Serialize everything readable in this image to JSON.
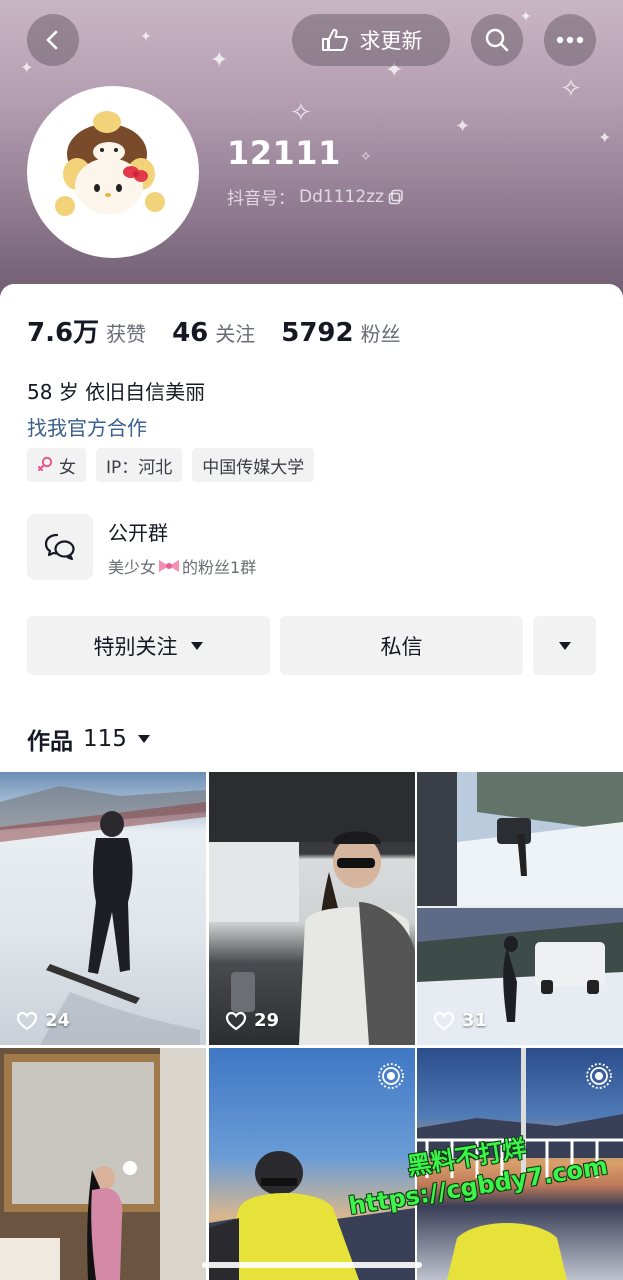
{
  "header": {
    "update_button_label": "求更新",
    "nickname": "12111",
    "douyin_id_label": "抖音号：",
    "douyin_id": "Dd1112zz"
  },
  "stats": [
    {
      "value": "7.6万",
      "label": "获赞"
    },
    {
      "value": "46",
      "label": "关注"
    },
    {
      "value": "5792",
      "label": "粉丝"
    }
  ],
  "bio": "58 岁 依旧自信美丽",
  "business_link": "找我官方合作",
  "tags": {
    "gender": "女",
    "ip": "IP：河北",
    "school": "中国传媒大学"
  },
  "group": {
    "title": "公开群",
    "subtitle_prefix": "美少女",
    "subtitle_suffix": "的粉丝1群"
  },
  "actions": {
    "follow_label": "特别关注",
    "message_label": "私信"
  },
  "works": {
    "label": "作品",
    "count": "115"
  },
  "grid": [
    {
      "likes": "24"
    },
    {
      "likes": "29"
    },
    {
      "likes": "31"
    },
    {
      "likes": ""
    },
    {
      "likes": ""
    },
    {
      "likes": ""
    }
  ],
  "watermark": {
    "line1": "黑料不打烊",
    "line2": "https://cgbdy7.com"
  },
  "colors": {
    "link": "#3a5f8f",
    "chip_bg": "#f2f2f3",
    "watermark": "#3cf44a"
  }
}
